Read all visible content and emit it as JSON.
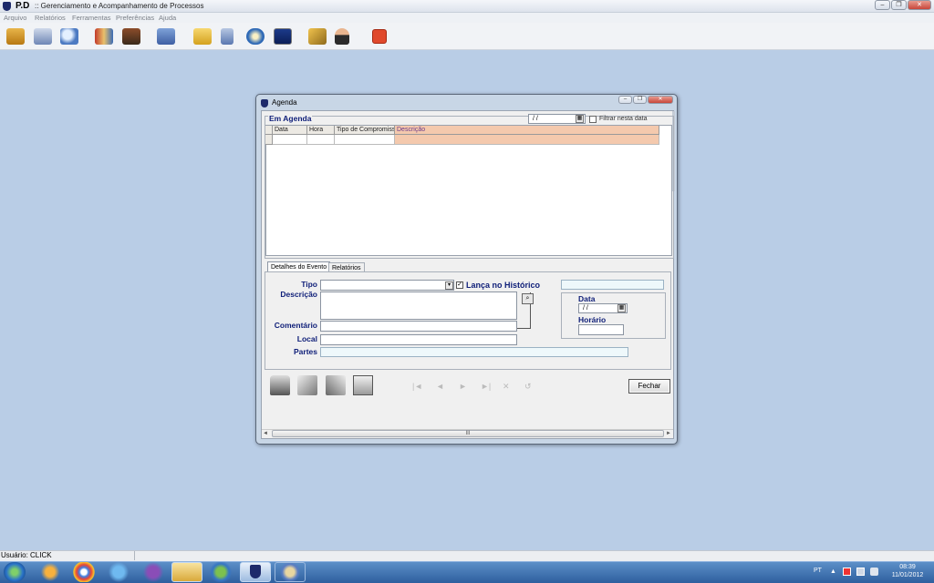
{
  "app": {
    "short_name": "P.D",
    "subtitle": ":: Gerenciamento e Acompanhamento de Processos"
  },
  "menu": {
    "items": [
      "Arquivo",
      "Relatórios",
      "Ferramentas",
      "Preferências",
      "Ajuda"
    ]
  },
  "toolbar": {
    "icons": [
      "briefcase-icon",
      "book-search-icon",
      "magnifier-icon",
      "gift-icon",
      "binder-icon",
      "folders-icon",
      "open-folder-icon",
      "calculator-icon",
      "compass-icon",
      "diskette-icon",
      "keys-icon",
      "user-icon",
      "power-icon"
    ]
  },
  "dialog": {
    "title": "Agenda",
    "section_title": "Em Agenda",
    "date_value": "/ /",
    "filter_label": "Filtrar nesta data",
    "grid": {
      "columns": [
        "Data",
        "Hora",
        "Tipo de Compromisso",
        "Descrição"
      ]
    },
    "tabs": [
      "Detalhes do Evento",
      "Relatórios"
    ],
    "fields": {
      "tipo": "Tipo",
      "lanca": "Lança no Histórico",
      "descricao": "Descrição",
      "comentario": "Comentário",
      "local": "Local",
      "partes": "Partes",
      "data": "Data",
      "data_value": "/ /",
      "horario": "Horário"
    },
    "nav_glyphs": [
      "|◄",
      "◄",
      "►",
      "►|",
      "✕",
      "↺"
    ],
    "close_button": "Fechar",
    "scroll_thumb": "III"
  },
  "status": {
    "user": "Usuário: CLICK"
  },
  "tray": {
    "lang": "PT",
    "time": "08:39",
    "date": "11/01/2012"
  },
  "colors": {
    "accent_header": "#f4c9ad",
    "label": "#0e1e78",
    "desktop": "#b9cde6"
  }
}
